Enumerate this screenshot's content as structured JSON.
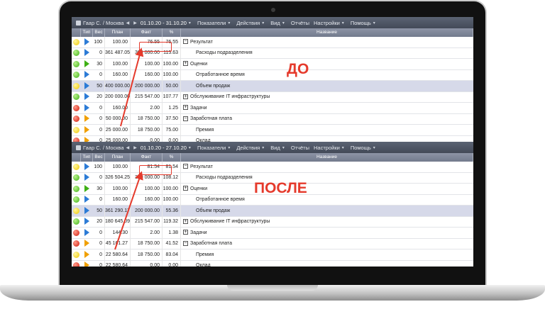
{
  "before": {
    "breadcrumb": "Гаар С. / Москва",
    "period": "01.10.20 - 31.10.20",
    "menus": [
      "Показатели",
      "Действия",
      "Вид",
      "Отчёты",
      "Настройки",
      "Помощь"
    ],
    "columns": {
      "type": "Тип",
      "weight": "Вес",
      "plan": "План",
      "fact": "Факт",
      "percent": "%",
      "name": "Название"
    },
    "rows": [
      {
        "status": "yellow",
        "flag": "blue",
        "weight": "100",
        "plan": "100.00",
        "fact": "76.55",
        "percent": "76.55",
        "name": "Результат",
        "level": 0,
        "tree": "−"
      },
      {
        "status": "green",
        "flag": "blue",
        "weight": "0",
        "plan": "361 487.05",
        "fact": "305 000.00",
        "percent": "115.63",
        "name": "Расходы подразделения",
        "level": 2,
        "tree": ""
      },
      {
        "status": "green",
        "flag": "green",
        "weight": "30",
        "plan": "100.00",
        "fact": "100.00",
        "percent": "100.00",
        "name": "Оценки",
        "level": 1,
        "tree": "+"
      },
      {
        "status": "green",
        "flag": "blue",
        "weight": "0",
        "plan": "160.00",
        "fact": "160.00",
        "percent": "100.00",
        "name": "Отработанное время",
        "level": 2,
        "tree": ""
      },
      {
        "status": "yellow",
        "flag": "blue",
        "weight": "50",
        "plan": "400 000.00",
        "fact": "200 000.00",
        "percent": "50.00",
        "name": "Объем продаж",
        "level": 2,
        "tree": "",
        "hl": true
      },
      {
        "status": "green",
        "flag": "blue",
        "weight": "20",
        "plan": "200 000.00",
        "fact": "215 547.00",
        "percent": "107.77",
        "name": "Обслуживание IT инфраструктуры",
        "level": 1,
        "tree": "+"
      },
      {
        "status": "red",
        "flag": "blue",
        "weight": "0",
        "plan": "160.00",
        "fact": "2.00",
        "percent": "1.25",
        "name": "Задачи",
        "level": 1,
        "tree": "+"
      },
      {
        "status": "red",
        "flag": "orange",
        "weight": "0",
        "plan": "50 000.00",
        "fact": "18 750.00",
        "percent": "37.50",
        "name": "Заработная плата",
        "level": 0,
        "tree": "−"
      },
      {
        "status": "yellow",
        "flag": "orange",
        "weight": "0",
        "plan": "25 000.00",
        "fact": "18 750.00",
        "percent": "75.00",
        "name": "Премия",
        "level": 2,
        "tree": ""
      },
      {
        "status": "red",
        "flag": "orange",
        "weight": "0",
        "plan": "25 000.00",
        "fact": "0.00",
        "percent": "0.00",
        "name": "Оклад",
        "level": 2,
        "tree": ""
      }
    ],
    "label": "ДО"
  },
  "after": {
    "breadcrumb": "Гаар С. / Москва",
    "period": "01.10.20 - 27.10.20",
    "menus": [
      "Показатели",
      "Действия",
      "Вид",
      "Отчёты",
      "Настройки",
      "Помощь"
    ],
    "columns": {
      "type": "Тип",
      "weight": "Вес",
      "plan": "План",
      "fact": "Факт",
      "percent": "%",
      "name": "Название"
    },
    "rows": [
      {
        "status": "yellow",
        "flag": "blue",
        "weight": "100",
        "plan": "100.00",
        "fact": "81.54",
        "percent": "81.54",
        "name": "Результат",
        "level": 0,
        "tree": "−"
      },
      {
        "status": "green",
        "flag": "blue",
        "weight": "0",
        "plan": "326 504.25",
        "fact": "300 000.00",
        "percent": "108.12",
        "name": "Расходы подразделения",
        "level": 2,
        "tree": ""
      },
      {
        "status": "green",
        "flag": "green",
        "weight": "30",
        "plan": "100.00",
        "fact": "100.00",
        "percent": "100.00",
        "name": "Оценки",
        "level": 1,
        "tree": "+"
      },
      {
        "status": "green",
        "flag": "blue",
        "weight": "0",
        "plan": "160.00",
        "fact": "160.00",
        "percent": "100.00",
        "name": "Отработанное время",
        "level": 2,
        "tree": ""
      },
      {
        "status": "yellow",
        "flag": "blue",
        "weight": "50",
        "plan": "361 290.17",
        "fact": "200 000.00",
        "percent": "55.36",
        "name": "Объем продаж",
        "level": 2,
        "tree": "",
        "hl": true
      },
      {
        "status": "green",
        "flag": "blue",
        "weight": "20",
        "plan": "180 645.09",
        "fact": "215 547.00",
        "percent": "119.32",
        "name": "Обслуживание IT инфраструктуры",
        "level": 1,
        "tree": "+"
      },
      {
        "status": "red",
        "flag": "blue",
        "weight": "0",
        "plan": "144.30",
        "fact": "2.00",
        "percent": "1.38",
        "name": "Задачи",
        "level": 1,
        "tree": "+"
      },
      {
        "status": "red",
        "flag": "orange",
        "weight": "0",
        "plan": "45 161.27",
        "fact": "18 750.00",
        "percent": "41.52",
        "name": "Заработная плата",
        "level": 0,
        "tree": "−"
      },
      {
        "status": "yellow",
        "flag": "orange",
        "weight": "0",
        "plan": "22 580.64",
        "fact": "18 750.00",
        "percent": "83.04",
        "name": "Премия",
        "level": 2,
        "tree": ""
      },
      {
        "status": "red",
        "flag": "orange",
        "weight": "0",
        "plan": "22 580.64",
        "fact": "0.00",
        "percent": "0.00",
        "name": "Оклад",
        "level": 2,
        "tree": ""
      }
    ],
    "label": "ПОСЛЕ"
  }
}
